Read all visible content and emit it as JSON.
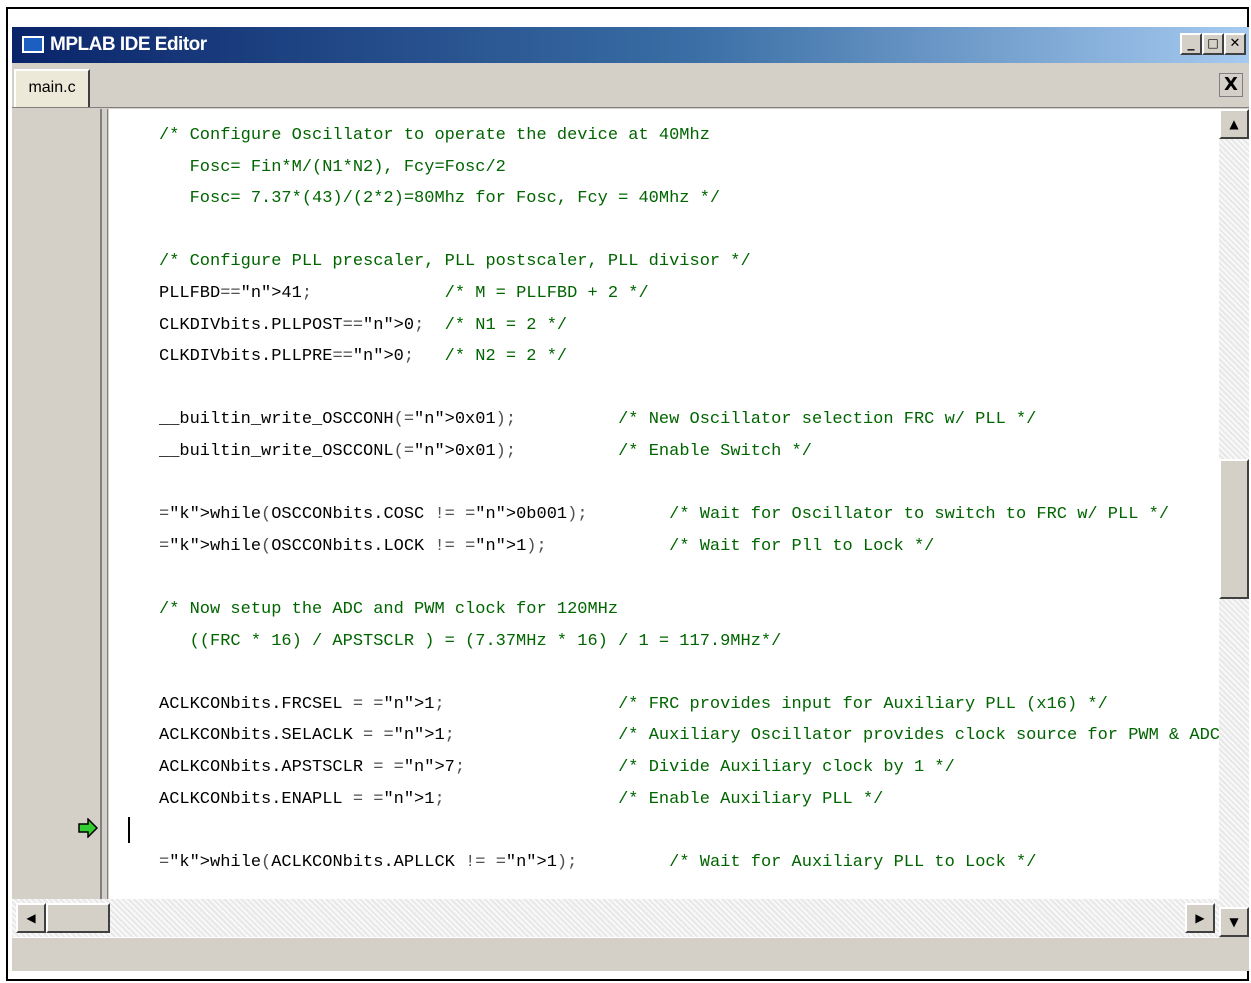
{
  "window": {
    "title": "MPLAB IDE Editor",
    "buttons": {
      "minimize": "_",
      "maximize": "□",
      "close": "✕"
    }
  },
  "tabs": [
    {
      "label": "main.c",
      "active": true
    }
  ],
  "doc_close": "X",
  "editor": {
    "lines": [
      "/* Configure Oscillator to operate the device at 40Mhz",
      "   Fosc= Fin*M/(N1*N2), Fcy=Fosc/2",
      "   Fosc= 7.37*(43)/(2*2)=80Mhz for Fosc, Fcy = 40Mhz */",
      "",
      "/* Configure PLL prescaler, PLL postscaler, PLL divisor */",
      "PLLFBD=41;             /* M = PLLFBD + 2 */",
      "CLKDIVbits.PLLPOST=0;  /* N1 = 2 */",
      "CLKDIVbits.PLLPRE=0;   /* N2 = 2 */",
      "",
      "__builtin_write_OSCCONH(0x01);          /* New Oscillator selection FRC w/ PLL */",
      "__builtin_write_OSCCONL(0x01);          /* Enable Switch */",
      "",
      "while(OSCCONbits.COSC != 0b001);        /* Wait for Oscillator to switch to FRC w/ PLL */",
      "while(OSCCONbits.LOCK != 1);            /* Wait for Pll to Lock */",
      "",
      "/* Now setup the ADC and PWM clock for 120MHz",
      "   ((FRC * 16) / APSTSCLR ) = (7.37MHz * 16) / 1 = 117.9MHz*/",
      "",
      "ACLKCONbits.FRCSEL = 1;                 /* FRC provides input for Auxiliary PLL (x16) */",
      "ACLKCONbits.SELACLK = 1;                /* Auxiliary Oscillator provides clock source for PWM & ADC",
      "ACLKCONbits.APSTSCLR = 7;               /* Divide Auxiliary clock by 1 */",
      "ACLKCONbits.ENAPLL = 1;                 /* Enable Auxiliary PLL */",
      "",
      "while(ACLKCONbits.APLLCK != 1);         /* Wait for Auxiliary PLL to Lock */"
    ],
    "current_line_index": 21,
    "execution_marker": "green-arrow-icon"
  },
  "scrollbars": {
    "up": "▲",
    "down": "▼",
    "left": "◀",
    "right": "▶"
  },
  "colors": {
    "title_start": "#0a246a",
    "title_end": "#a6caf0",
    "comment": "#006400",
    "number": "#1e3cff",
    "keyword": "#0a1a9a",
    "exec_arrow": "#33cc33"
  }
}
